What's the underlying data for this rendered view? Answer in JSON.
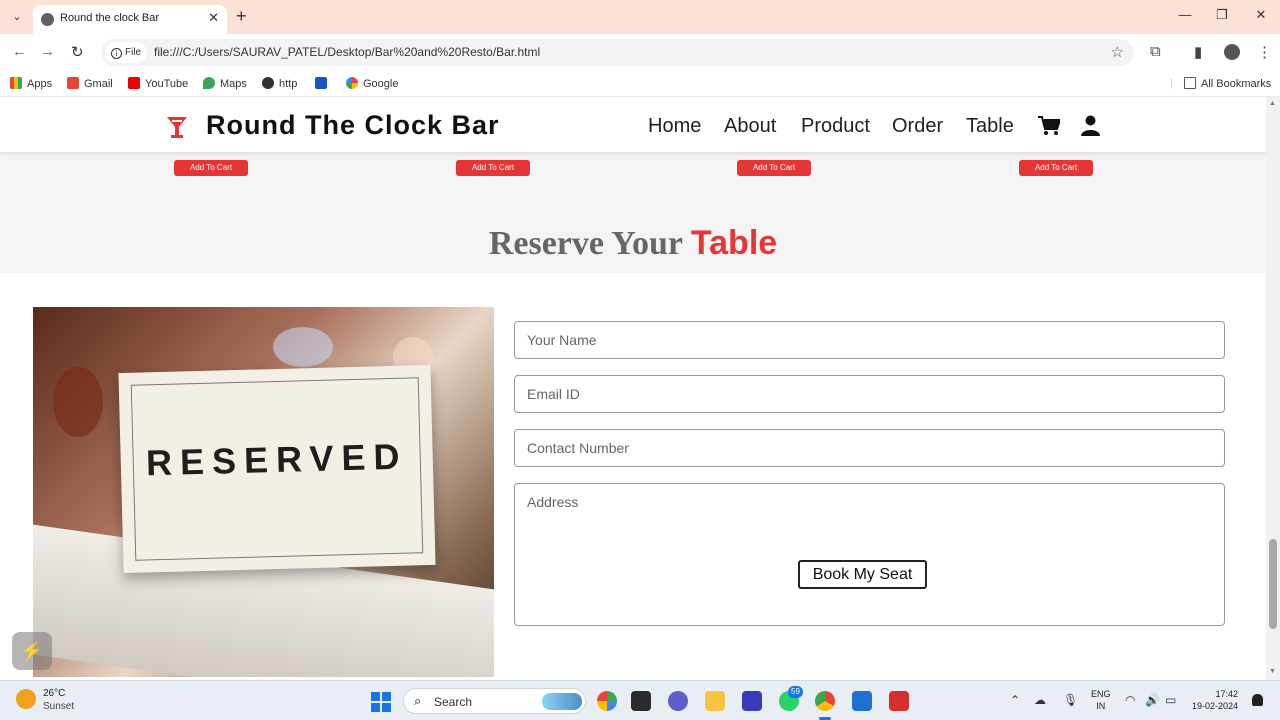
{
  "browser": {
    "tab_title": "Round the clock Bar",
    "file_chip": "File",
    "url": "file:///C:/Users/SAURAV_PATEL/Desktop/Bar%20and%20Resto/Bar.html",
    "bookmarks": [
      "Apps",
      "Gmail",
      "YouTube",
      "Maps",
      "http",
      "Google"
    ],
    "all_bookmarks": "All Bookmarks"
  },
  "site": {
    "brand": "Round The Clock Bar",
    "nav": [
      "Home",
      "About",
      "Product",
      "Order",
      "Table"
    ],
    "add_to_cart_label": "Add To Cart",
    "section_title_main": "Reserve Your",
    "section_title_accent": "Table",
    "image_text": "RESERVED",
    "form": {
      "name_placeholder": "Your Name",
      "email_placeholder": "Email ID",
      "contact_placeholder": "Contact Number",
      "address_placeholder": "Address",
      "submit_label": "Book My Seat"
    }
  },
  "taskbar": {
    "temperature": "26°C",
    "weather_desc": "Sunset",
    "search_label": "Search",
    "whatsapp_badge": "59",
    "lang_top": "ENG",
    "lang_bottom": "IN",
    "time": "17:42",
    "date": "19-02-2024"
  },
  "colors": {
    "accent": "#e53535",
    "tab_bar": "#fbe1d6",
    "page_bg": "#f4f4f4"
  }
}
